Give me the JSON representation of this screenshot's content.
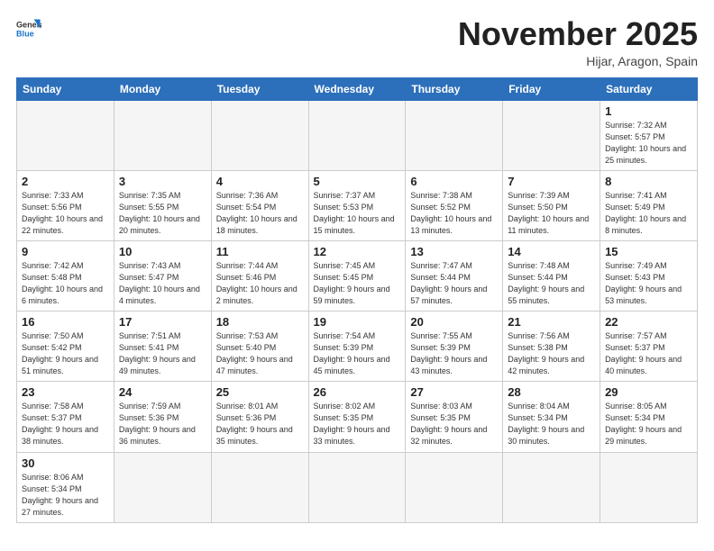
{
  "logo": {
    "text_general": "General",
    "text_blue": "Blue"
  },
  "title": "November 2025",
  "location": "Hijar, Aragon, Spain",
  "days_of_week": [
    "Sunday",
    "Monday",
    "Tuesday",
    "Wednesday",
    "Thursday",
    "Friday",
    "Saturday"
  ],
  "weeks": [
    [
      {
        "day": "",
        "empty": true
      },
      {
        "day": "",
        "empty": true
      },
      {
        "day": "",
        "empty": true
      },
      {
        "day": "",
        "empty": true
      },
      {
        "day": "",
        "empty": true
      },
      {
        "day": "",
        "empty": true
      },
      {
        "day": "1",
        "info": "Sunrise: 7:32 AM\nSunset: 5:57 PM\nDaylight: 10 hours\nand 25 minutes."
      }
    ],
    [
      {
        "day": "2",
        "info": "Sunrise: 7:33 AM\nSunset: 5:56 PM\nDaylight: 10 hours\nand 22 minutes."
      },
      {
        "day": "3",
        "info": "Sunrise: 7:35 AM\nSunset: 5:55 PM\nDaylight: 10 hours\nand 20 minutes."
      },
      {
        "day": "4",
        "info": "Sunrise: 7:36 AM\nSunset: 5:54 PM\nDaylight: 10 hours\nand 18 minutes."
      },
      {
        "day": "5",
        "info": "Sunrise: 7:37 AM\nSunset: 5:53 PM\nDaylight: 10 hours\nand 15 minutes."
      },
      {
        "day": "6",
        "info": "Sunrise: 7:38 AM\nSunset: 5:52 PM\nDaylight: 10 hours\nand 13 minutes."
      },
      {
        "day": "7",
        "info": "Sunrise: 7:39 AM\nSunset: 5:50 PM\nDaylight: 10 hours\nand 11 minutes."
      },
      {
        "day": "8",
        "info": "Sunrise: 7:41 AM\nSunset: 5:49 PM\nDaylight: 10 hours\nand 8 minutes."
      }
    ],
    [
      {
        "day": "9",
        "info": "Sunrise: 7:42 AM\nSunset: 5:48 PM\nDaylight: 10 hours\nand 6 minutes."
      },
      {
        "day": "10",
        "info": "Sunrise: 7:43 AM\nSunset: 5:47 PM\nDaylight: 10 hours\nand 4 minutes."
      },
      {
        "day": "11",
        "info": "Sunrise: 7:44 AM\nSunset: 5:46 PM\nDaylight: 10 hours\nand 2 minutes."
      },
      {
        "day": "12",
        "info": "Sunrise: 7:45 AM\nSunset: 5:45 PM\nDaylight: 9 hours\nand 59 minutes."
      },
      {
        "day": "13",
        "info": "Sunrise: 7:47 AM\nSunset: 5:44 PM\nDaylight: 9 hours\nand 57 minutes."
      },
      {
        "day": "14",
        "info": "Sunrise: 7:48 AM\nSunset: 5:44 PM\nDaylight: 9 hours\nand 55 minutes."
      },
      {
        "day": "15",
        "info": "Sunrise: 7:49 AM\nSunset: 5:43 PM\nDaylight: 9 hours\nand 53 minutes."
      }
    ],
    [
      {
        "day": "16",
        "info": "Sunrise: 7:50 AM\nSunset: 5:42 PM\nDaylight: 9 hours\nand 51 minutes."
      },
      {
        "day": "17",
        "info": "Sunrise: 7:51 AM\nSunset: 5:41 PM\nDaylight: 9 hours\nand 49 minutes."
      },
      {
        "day": "18",
        "info": "Sunrise: 7:53 AM\nSunset: 5:40 PM\nDaylight: 9 hours\nand 47 minutes."
      },
      {
        "day": "19",
        "info": "Sunrise: 7:54 AM\nSunset: 5:39 PM\nDaylight: 9 hours\nand 45 minutes."
      },
      {
        "day": "20",
        "info": "Sunrise: 7:55 AM\nSunset: 5:39 PM\nDaylight: 9 hours\nand 43 minutes."
      },
      {
        "day": "21",
        "info": "Sunrise: 7:56 AM\nSunset: 5:38 PM\nDaylight: 9 hours\nand 42 minutes."
      },
      {
        "day": "22",
        "info": "Sunrise: 7:57 AM\nSunset: 5:37 PM\nDaylight: 9 hours\nand 40 minutes."
      }
    ],
    [
      {
        "day": "23",
        "info": "Sunrise: 7:58 AM\nSunset: 5:37 PM\nDaylight: 9 hours\nand 38 minutes."
      },
      {
        "day": "24",
        "info": "Sunrise: 7:59 AM\nSunset: 5:36 PM\nDaylight: 9 hours\nand 36 minutes."
      },
      {
        "day": "25",
        "info": "Sunrise: 8:01 AM\nSunset: 5:36 PM\nDaylight: 9 hours\nand 35 minutes."
      },
      {
        "day": "26",
        "info": "Sunrise: 8:02 AM\nSunset: 5:35 PM\nDaylight: 9 hours\nand 33 minutes."
      },
      {
        "day": "27",
        "info": "Sunrise: 8:03 AM\nSunset: 5:35 PM\nDaylight: 9 hours\nand 32 minutes."
      },
      {
        "day": "28",
        "info": "Sunrise: 8:04 AM\nSunset: 5:34 PM\nDaylight: 9 hours\nand 30 minutes."
      },
      {
        "day": "29",
        "info": "Sunrise: 8:05 AM\nSunset: 5:34 PM\nDaylight: 9 hours\nand 29 minutes."
      }
    ],
    [
      {
        "day": "30",
        "info": "Sunrise: 8:06 AM\nSunset: 5:34 PM\nDaylight: 9 hours\nand 27 minutes."
      },
      {
        "day": "",
        "empty": true
      },
      {
        "day": "",
        "empty": true
      },
      {
        "day": "",
        "empty": true
      },
      {
        "day": "",
        "empty": true
      },
      {
        "day": "",
        "empty": true
      },
      {
        "day": "",
        "empty": true
      }
    ]
  ]
}
